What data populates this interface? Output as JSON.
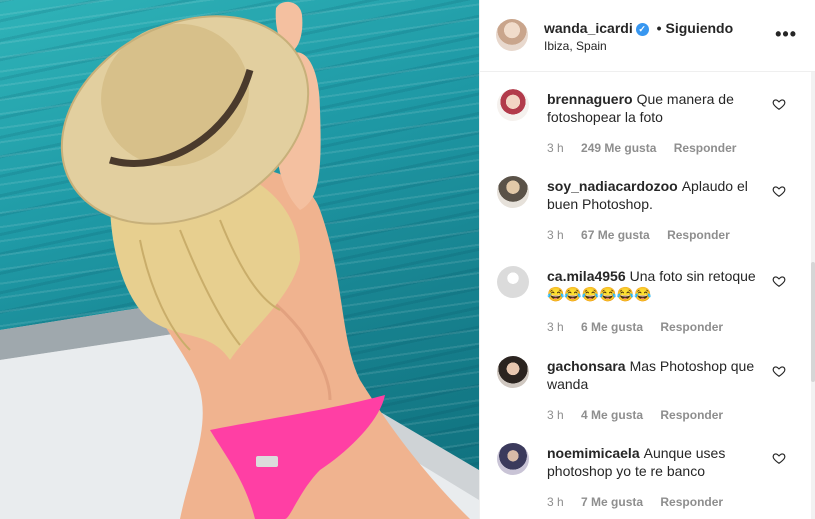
{
  "post": {
    "username": "wanda_icardi",
    "verified_icon": "verified-badge-icon",
    "separator": "•",
    "follow_status": "Siguiendo",
    "location": "Ibiza, Spain",
    "more_icon": "more-options-icon",
    "more_glyph": "•••"
  },
  "comments": [
    {
      "username": "brennaguero",
      "text": "Que manera de fotoshopear la foto",
      "time": "3 h",
      "likes": "249 Me gusta",
      "reply": "Responder"
    },
    {
      "username": "soy_nadiacardozoo",
      "text": "Aplaudo el buen Photoshop.",
      "time": "3 h",
      "likes": "67 Me gusta",
      "reply": "Responder"
    },
    {
      "username": "ca.mila4956",
      "text": "Una foto sin retoque 😂😂😂😂😂😂",
      "time": "3 h",
      "likes": "6 Me gusta",
      "reply": "Responder"
    },
    {
      "username": "gachonsara",
      "text": "Mas Photoshop que wanda",
      "time": "3 h",
      "likes": "4 Me gusta",
      "reply": "Responder"
    },
    {
      "username": "noemimicaela",
      "text": "Aunque uses photoshop yo te re banco",
      "time": "3 h",
      "likes": "7 Me gusta",
      "reply": "Responder"
    }
  ],
  "colors": {
    "accent_blue": "#3897f0",
    "meta_gray": "#8e8e8e",
    "text": "#262626",
    "sea": "#1f9aa6",
    "bikini_pink": "#ff3fa4"
  }
}
